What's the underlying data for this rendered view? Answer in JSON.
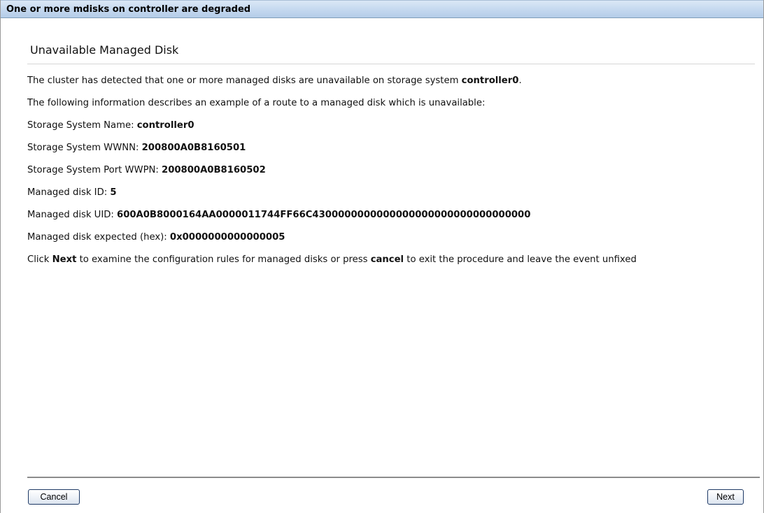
{
  "window": {
    "title": "One or more mdisks on controller are degraded"
  },
  "panel": {
    "heading": "Unavailable Managed Disk"
  },
  "info": {
    "intro_prefix": "The cluster has detected that one or more managed disks are unavailable on storage system ",
    "intro_system": "controller0",
    "intro_suffix": ".",
    "route_text": "The following information describes an example of a route to a managed disk which is unavailable:",
    "storage_system_name_label": "Storage System Name: ",
    "storage_system_name_value": "controller0",
    "storage_system_wwnn_label": "Storage System WWNN: ",
    "storage_system_wwnn_value": "200800A0B8160501",
    "storage_system_port_wwpn_label": "Storage System Port WWPN: ",
    "storage_system_port_wwpn_value": "200800A0B8160502",
    "managed_disk_id_label": "Managed disk ID: ",
    "managed_disk_id_value": "5",
    "managed_disk_uid_label": "Managed disk UID: ",
    "managed_disk_uid_value": "600A0B8000164AA0000011744FF66C4300000000000000000000000000000000",
    "managed_disk_expected_label": "Managed disk expected (hex): ",
    "managed_disk_expected_value": "0x0000000000000005",
    "instruction_prefix": "Click ",
    "instruction_next": "Next",
    "instruction_middle": " to examine the configuration rules for managed disks or press ",
    "instruction_cancel": "cancel",
    "instruction_suffix": " to exit the procedure and leave the event unfixed"
  },
  "buttons": {
    "cancel_label": "Cancel",
    "next_label": "Next"
  },
  "colors": {
    "titlebar_top": "#dbe8f6",
    "titlebar_bottom": "#b4cce8",
    "button_border": "#1f3a66"
  }
}
